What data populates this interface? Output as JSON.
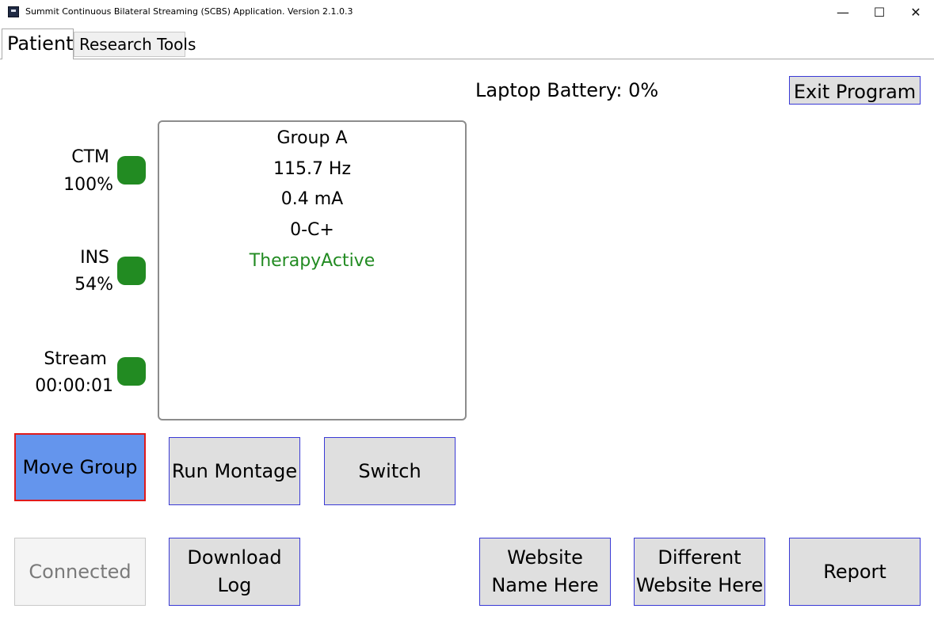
{
  "window": {
    "title": "Summit Continuous Bilateral Streaming (SCBS) Application. Version 2.1.0.3",
    "minimize_glyph": "—",
    "maximize_glyph": "☐",
    "close_glyph": "✕"
  },
  "tabs": [
    {
      "label": "Patient",
      "active": true
    },
    {
      "label": "Research Tools",
      "active": false
    }
  ],
  "header": {
    "battery_label": "Laptop Battery: 0%",
    "exit_label": "Exit Program"
  },
  "status": [
    {
      "name": "CTM",
      "value": "100%",
      "color": "#228b22"
    },
    {
      "name": "INS",
      "value": "54%",
      "color": "#228b22"
    },
    {
      "name": "Stream",
      "value": "00:00:01",
      "color": "#228b22"
    }
  ],
  "group_info": {
    "group": "Group A",
    "frequency": "115.7 Hz",
    "amplitude": "0.4 mA",
    "electrodes": "0-C+",
    "state": "TherapyActive",
    "state_color": "#228b22"
  },
  "buttons": {
    "move_group": "Move Group",
    "run_montage": "Run Montage",
    "switch": "Switch",
    "connected": "Connected",
    "download_log": "Download\nLog",
    "website": "Website\nName Here",
    "different_website": "Different\nWebsite Here",
    "report": "Report"
  },
  "colors": {
    "accent": "#6495ed",
    "focus_border": "#e01b1b",
    "button_border": "#3a3ad6",
    "led_green": "#228b22"
  }
}
